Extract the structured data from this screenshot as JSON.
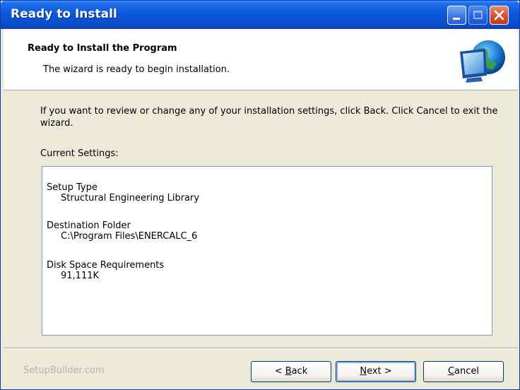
{
  "window": {
    "title": "Ready to Install"
  },
  "header": {
    "title": "Ready to Install the Program",
    "subtitle": "The wizard is ready to begin installation."
  },
  "intro_text": "If you want to review or change any of your installation settings, click Back. Click Cancel to exit the wizard.",
  "current_settings_label": "Current Settings:",
  "settings": [
    {
      "label": "Setup Type",
      "value": "Structural Engineering Library"
    },
    {
      "label": "Destination Folder",
      "value": "C:\\Program Files\\ENERCALC_6"
    },
    {
      "label": "Disk Space Requirements",
      "value": "91,111K"
    }
  ],
  "footer": {
    "brand": "SetupBuilder.com",
    "back_mnemonic": "B",
    "back_rest": "ack",
    "back_prefix": "< ",
    "next_mnemonic": "N",
    "next_rest": "ext >",
    "cancel_mnemonic": "C",
    "cancel_rest": "ancel"
  },
  "icons": {
    "logo": "monitor-globe-icon",
    "minimize": "minimize-icon",
    "maximize": "maximize-icon",
    "close": "close-icon"
  }
}
